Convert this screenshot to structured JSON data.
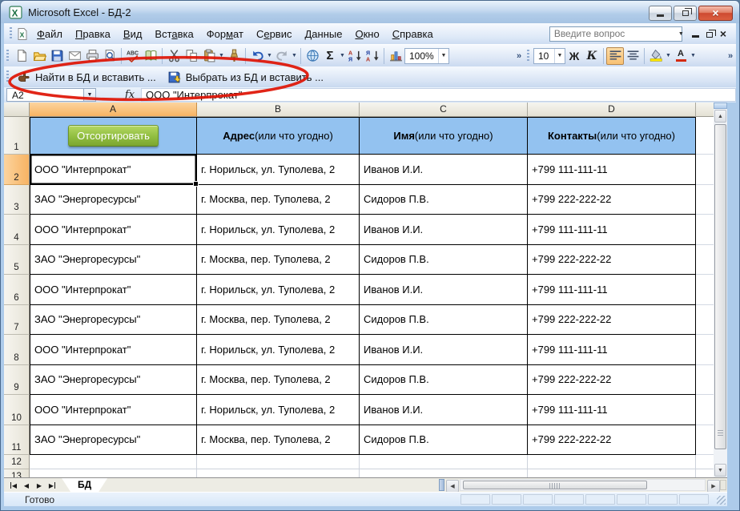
{
  "window": {
    "title": "Microsoft Excel - БД-2"
  },
  "menu": {
    "items": [
      {
        "label": "Файл",
        "key_index": 0
      },
      {
        "label": "Правка",
        "key_index": 0
      },
      {
        "label": "Вид",
        "key_index": 0
      },
      {
        "label": "Вставка",
        "key_index": 3
      },
      {
        "label": "Формат",
        "key_index": 3
      },
      {
        "label": "Сервис",
        "key_index": 1
      },
      {
        "label": "Данные",
        "key_index": 0
      },
      {
        "label": "Окно",
        "key_index": 0
      },
      {
        "label": "Справка",
        "key_index": 0
      }
    ],
    "question_box_placeholder": "Введите вопрос"
  },
  "toolbar_standard": {
    "zoom_value": "100%",
    "items": [
      "grip",
      "new-document-icon",
      "open-folder-icon",
      "save-icon",
      "email-icon",
      "print-icon",
      "print-preview-icon",
      "|",
      "spelling-icon",
      "research-icon",
      "|",
      "cut-icon",
      "copy-icon",
      "paste-icon+dd",
      "format-painter-icon",
      "|",
      "undo-icon+dd",
      "redo-icon+dd",
      "|",
      "hyperlink-icon",
      "autosum-icon+dd",
      "sort-ascending-icon",
      "sort-descending-icon",
      "|",
      "chart-wizard-icon",
      "zoom-select",
      "chevron"
    ]
  },
  "toolbar_formatting": {
    "font_size": "10",
    "bold_label": "Ж",
    "italic_label": "К",
    "items": [
      "grip",
      "font-size-select",
      "bold",
      "italic",
      "|",
      "align-left-icon:active",
      "align-center-icon",
      "|",
      "fill-color-icon+dd",
      "font-color-icon+dd",
      "chevron"
    ]
  },
  "custom_toolbar": {
    "buttons": [
      {
        "icon": "find-hand-icon",
        "label": "Найти в БД и вставить ..."
      },
      {
        "icon": "floppy-select-icon",
        "label": "Выбрать из БД и вставить ..."
      }
    ]
  },
  "formula_bar": {
    "name_box": "A2",
    "formula": "ООО \"Интерпрокат\""
  },
  "grid": {
    "columns": [
      "A",
      "B",
      "C",
      "D"
    ],
    "selected_column": "A",
    "selected_row": 2,
    "header_row": {
      "sort_button_label": "Отсортировать",
      "headers": [
        {
          "bold": "Адрес",
          "normal": " (или что угодно)"
        },
        {
          "bold": "Имя",
          "normal": " (или что угодно)"
        },
        {
          "bold": "Контакты",
          "normal": " (или что угодно)"
        }
      ]
    },
    "data_rows": [
      [
        "ООО \"Интерпрокат\"",
        "г. Норильск, ул. Туполева, 2",
        "Иванов И.И.",
        "+799 111-111-11"
      ],
      [
        "ЗАО \"Энергоресурсы\"",
        "г. Москва, пер. Туполева, 2",
        "Сидоров П.В.",
        "+799 222-222-22"
      ],
      [
        "ООО \"Интерпрокат\"",
        "г. Норильск, ул. Туполева, 2",
        "Иванов И.И.",
        "+799 111-111-11"
      ],
      [
        "ЗАО \"Энергоресурсы\"",
        "г. Москва, пер. Туполева, 2",
        "Сидоров П.В.",
        "+799 222-222-22"
      ],
      [
        "ООО \"Интерпрокат\"",
        "г. Норильск, ул. Туполева, 2",
        "Иванов И.И.",
        "+799 111-111-11"
      ],
      [
        "ЗАО \"Энергоресурсы\"",
        "г. Москва, пер. Туполева, 2",
        "Сидоров П.В.",
        "+799 222-222-22"
      ],
      [
        "ООО \"Интерпрокат\"",
        "г. Норильск, ул. Туполева, 2",
        "Иванов И.И.",
        "+799 111-111-11"
      ],
      [
        "ЗАО \"Энергоресурсы\"",
        "г. Москва, пер. Туполева, 2",
        "Сидоров П.В.",
        "+799 222-222-22"
      ],
      [
        "ООО \"Интерпрокат\"",
        "г. Норильск, ул. Туполева, 2",
        "Иванов И.И.",
        "+799 111-111-11"
      ],
      [
        "ЗАО \"Энергоресурсы\"",
        "г. Москва, пер. Туполева, 2",
        "Сидоров П.В.",
        "+799 222-222-22"
      ]
    ],
    "trailing_empty_rows": [
      12,
      13
    ]
  },
  "sheet_tabs": {
    "tabs": [
      "БД"
    ],
    "active": "БД"
  },
  "status_bar": {
    "text": "Готово"
  },
  "colors": {
    "header_fill_blue": "#93C2F0",
    "selection_orange": "#F7B363",
    "button_green": "#7CA62F",
    "annotation_red": "#DF1405"
  }
}
